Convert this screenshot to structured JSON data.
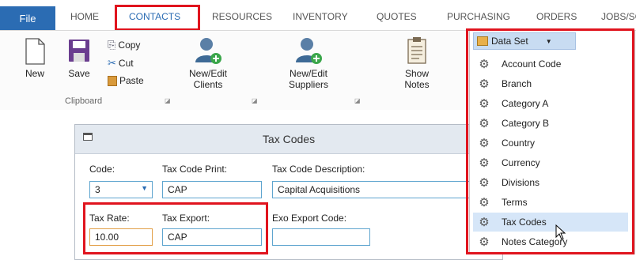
{
  "tabs": {
    "file": "File",
    "home": "HOME",
    "contacts": "CONTACTS",
    "resources": "RESOURCES",
    "inventory": "INVENTORY",
    "quotes": "QUOTES",
    "purchasing": "PURCHASING",
    "orders": "ORDERS",
    "jobs": "JOBS/SC"
  },
  "ribbon": {
    "new": "New",
    "save": "Save",
    "copy": "Copy",
    "cut": "Cut",
    "paste": "Paste",
    "clipboard_group": "Clipboard",
    "clients_line1": "New/Edit",
    "clients_line2": "Clients",
    "suppliers_line1": "New/Edit",
    "suppliers_line2": "Suppliers",
    "notes_line1": "Show",
    "notes_line2": "Notes"
  },
  "dialog": {
    "title": "Tax Codes",
    "code_label": "Code:",
    "code_value": "3",
    "tax_code_print_label": "Tax Code Print:",
    "tax_code_print_value": "CAP",
    "tax_code_description_label": "Tax Code Description:",
    "tax_code_description_value": "Capital Acquisitions",
    "tax_rate_label": "Tax Rate:",
    "tax_rate_value": "10.00",
    "tax_export_label": "Tax Export:",
    "tax_export_value": "CAP",
    "exo_export_code_label": "Exo Export Code:",
    "exo_export_code_value": ""
  },
  "dataset": {
    "label": "Data Set",
    "items": [
      "Account Code",
      "Branch",
      "Category A",
      "Category B",
      "Country",
      "Currency",
      "Divisions",
      "Terms",
      "Tax Codes",
      "Notes Category"
    ],
    "highlighted": "Tax Codes"
  },
  "colors": {
    "accent": "#2b6cb3",
    "highlight_red": "#e0141e",
    "menu_highlight": "#d6e6f8"
  }
}
